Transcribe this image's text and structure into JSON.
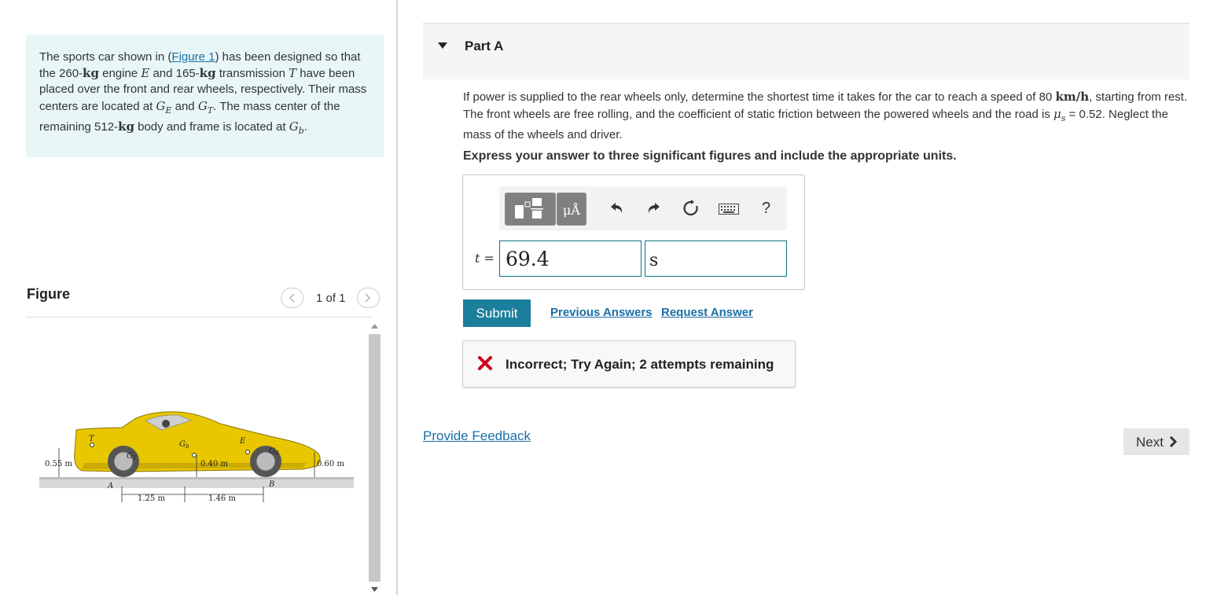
{
  "problem": {
    "text_1": "The sports car shown in (",
    "figure_link": "Figure 1",
    "text_2": ") has been designed so that the 260-",
    "kg": "kg",
    "text_3": " engine ",
    "E": "E",
    "text_4": " and 165-",
    "text_5": " transmission ",
    "T": "T",
    "text_6": " have been placed over the front and rear wheels, respectively. Their mass centers are located at ",
    "G": "G",
    "sub_E": "E",
    "text_7": " and ",
    "sub_T": "T",
    "text_8": ". The mass center of the remaining 512-",
    "text_9": " body and frame is located at ",
    "sub_b": "b",
    "text_10": "."
  },
  "figure": {
    "title": "Figure",
    "counter": "1 of 1",
    "labels": {
      "T": "T",
      "Gb": "G",
      "Gb_sub": "b",
      "E": "E",
      "GT": "G",
      "GT_sub": "T",
      "GE": "G",
      "GE_sub": "E",
      "h_left": "0.55 m",
      "h_mid": "0.40 m",
      "h_right": "0.60 m",
      "A": "A",
      "B": "B",
      "d1": "1.25 m",
      "d2": "1.46 m"
    },
    "colors": {
      "car_body": "#e8c700",
      "car_shadow": "#b99a00",
      "ground": "#cfcfcf"
    }
  },
  "part": {
    "title": "Part A",
    "question_1": "If power is supplied to the rear wheels only, determine the shortest time it takes for the car to reach a speed of 80 ",
    "unit_speed": "km/h",
    "question_2": ", starting from rest. The front wheels are free rolling, and the coefficient of static friction between the powered wheels and the road is ",
    "mu": "μ",
    "mu_sub": "s",
    "question_3": " = 0.52. Neglect the mass of the wheels and driver.",
    "instruction": "Express your answer to three significant figures and include the appropriate units."
  },
  "answer": {
    "mu_button": "μÅ",
    "help": "?",
    "var_label": "t =",
    "value": "69.4",
    "unit": "s",
    "submit": "Submit",
    "previous_answers": "Previous Answers",
    "request_answer": "Request Answer"
  },
  "feedback": {
    "text": "Incorrect; Try Again; 2 attempts remaining",
    "color": "#d0021b"
  },
  "footer": {
    "provide_feedback": "Provide Feedback",
    "next": "Next"
  },
  "colors": {
    "accent": "#1b7e9c",
    "link": "#1a6fa6",
    "panel": "#e8f6f7"
  }
}
